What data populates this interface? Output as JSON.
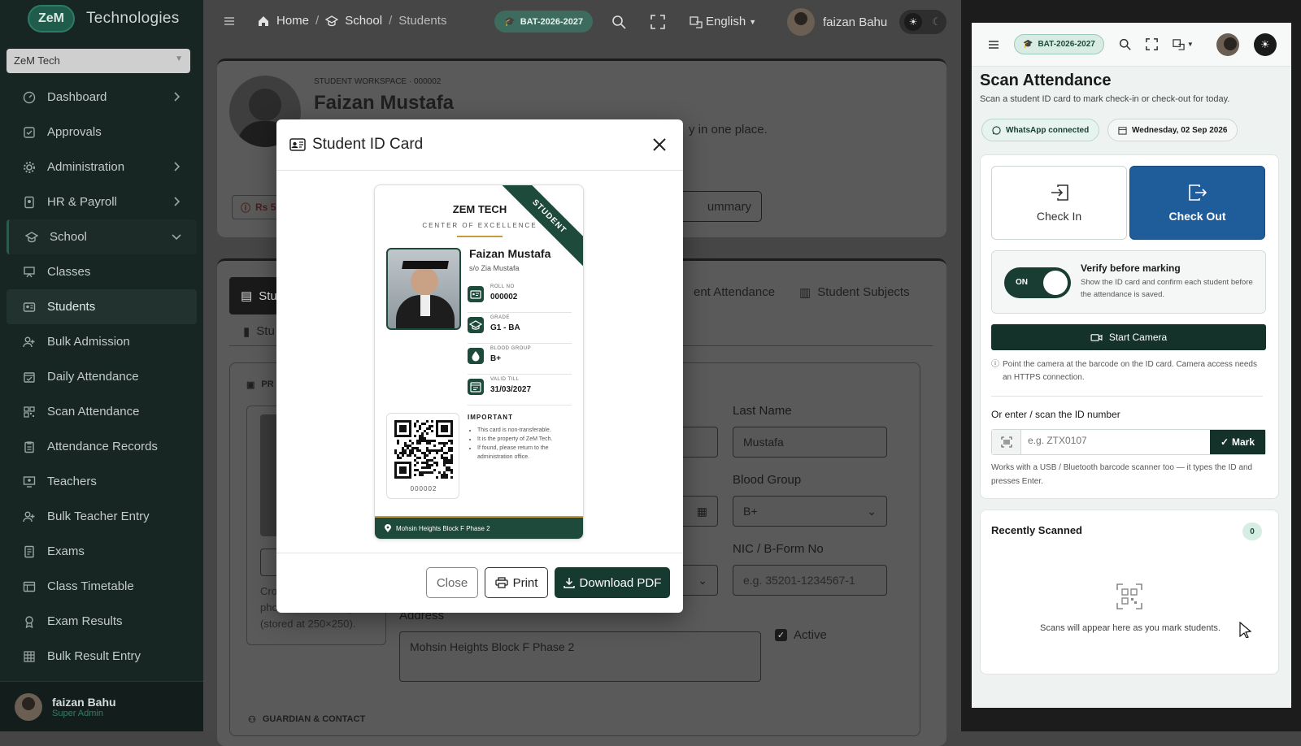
{
  "sidebar": {
    "brand_logo": "ZeM",
    "brand_name": "Technologies",
    "org_select": "ZeM Tech",
    "items": [
      {
        "label": "Dashboard",
        "icon": "gauge-icon",
        "arrow": true
      },
      {
        "label": "Approvals",
        "icon": "check-square-icon",
        "arrow": false
      },
      {
        "label": "Administration",
        "icon": "gear-icon",
        "arrow": true
      },
      {
        "label": "HR & Payroll",
        "icon": "id-badge-icon",
        "arrow": true
      },
      {
        "label": "School",
        "icon": "school-icon",
        "arrow": "down"
      },
      {
        "label": "Classes",
        "icon": "easel-icon",
        "arrow": false
      },
      {
        "label": "Students",
        "icon": "students-icon",
        "arrow": false
      },
      {
        "label": "Bulk Admission",
        "icon": "user-plus-icon",
        "arrow": false
      },
      {
        "label": "Daily Attendance",
        "icon": "calendar-check-icon",
        "arrow": false
      },
      {
        "label": "Scan Attendance",
        "icon": "qr-icon",
        "arrow": false
      },
      {
        "label": "Attendance Records",
        "icon": "clipboard-icon",
        "arrow": false
      },
      {
        "label": "Teachers",
        "icon": "teacher-icon",
        "arrow": false
      },
      {
        "label": "Bulk Teacher Entry",
        "icon": "user-plus-icon",
        "arrow": false
      },
      {
        "label": "Exams",
        "icon": "exam-icon",
        "arrow": false
      },
      {
        "label": "Class Timetable",
        "icon": "timetable-icon",
        "arrow": false
      },
      {
        "label": "Exam Results",
        "icon": "award-icon",
        "arrow": false
      },
      {
        "label": "Bulk Result Entry",
        "icon": "grid-icon",
        "arrow": false
      }
    ],
    "user": {
      "name": "faizan Bahu",
      "role": "Super Admin"
    }
  },
  "topbar": {
    "breadcrumb": [
      "Home",
      "School",
      "Students"
    ],
    "session": "BAT-2026-2027",
    "language": "English",
    "user": "faizan Bahu"
  },
  "profile": {
    "workspace": "STUDENT WORKSPACE · 000002",
    "name": "Faizan Mustafa",
    "blurb_tail": "y in one place.",
    "fee_chip": "Rs 5,",
    "summary_btn": "ummary"
  },
  "tabs": {
    "first": "Stu",
    "attendance": "ent Attendance",
    "subjects": "Student Subjects",
    "second_row": "Stu"
  },
  "form": {
    "pr_label": "PR",
    "last_name_label": "Last Name",
    "last_name": "Mustafa",
    "blood_group_label": "Blood Group",
    "blood_group": "B+",
    "nic_label": "NIC / B-Form No",
    "nic_placeholder": "e.g. 35201-1234567-1",
    "address_label": "Address",
    "address": "Mohsin Heights Block F Phase 2",
    "active_label": "Active",
    "crop_line1": "Cro",
    "crop_line2": "photo before saving",
    "crop_line3": "(stored at 250×250).",
    "guardian_section": "GUARDIAN & CONTACT"
  },
  "modal": {
    "title": "Student ID Card",
    "card": {
      "org": "ZEM TECH",
      "tagline": "CENTER OF EXCELLENCE",
      "ribbon": "STUDENT",
      "name": "Faizan Mustafa",
      "parent": "s/o Zia Mustafa",
      "rows": [
        {
          "key": "ROLL NO",
          "value": "000002",
          "icon": "id-card-icon"
        },
        {
          "key": "GRADE",
          "value": "G1 - BA",
          "icon": "graduation-cap-icon"
        },
        {
          "key": "BLOOD GROUP",
          "value": "B+",
          "icon": "droplet-icon"
        },
        {
          "key": "VALID TILL",
          "value": "31/03/2027",
          "icon": "calendar-icon"
        }
      ],
      "qr_caption": "000002",
      "important_title": "IMPORTANT",
      "notes": [
        "This card is non-transferable.",
        "It is the property of ZeM Tech.",
        "If found, please return to the administration office."
      ],
      "address": "Mohsin Heights Block F Phase 2"
    },
    "close_label": "Close",
    "print_label": "Print",
    "download_label": "Download PDF"
  },
  "scan": {
    "session": "BAT-2026-2027",
    "title": "Scan Attendance",
    "subtitle": "Scan a student ID card to mark check-in or check-out for today.",
    "whatsapp": "WhatsApp connected",
    "date": "Wednesday, 02 Sep 2026",
    "check_in": "Check In",
    "check_out": "Check Out",
    "toggle_label": "ON",
    "verify_title": "Verify before marking",
    "verify_desc": "Show the ID card and confirm each student before the attendance is saved.",
    "start_camera": "Start Camera",
    "camera_hint": "Point the camera at the barcode on the ID card. Camera access needs an HTTPS connection.",
    "manual_label": "Or enter / scan the ID number",
    "manual_placeholder": "e.g. ZTX0107",
    "mark_label": "Mark",
    "scanner_hint": "Works with a USB / Bluetooth barcode scanner too — it types the ID and presses Enter.",
    "recent_title": "Recently Scanned",
    "recent_count": "0",
    "empty_text": "Scans will appear here as you mark students."
  },
  "colors": {
    "accent": "#1e4a3c",
    "sidebar": "#172523",
    "gold": "#c79a3a"
  }
}
